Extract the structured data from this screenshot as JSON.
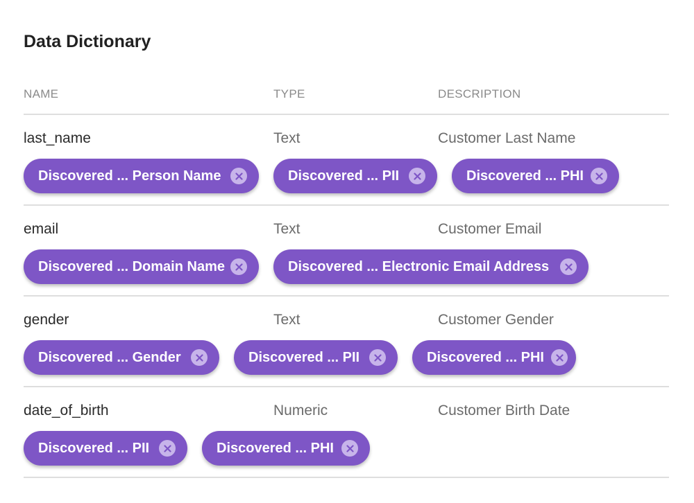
{
  "title": "Data Dictionary",
  "columns": {
    "name": "NAME",
    "type": "TYPE",
    "description": "DESCRIPTION"
  },
  "colors": {
    "chip_background": "#7e56c6",
    "chip_close_background": "#c7b4ea",
    "divider": "#dedede"
  },
  "rows": [
    {
      "name": "last_name",
      "type": "Text",
      "description": "Customer Last Name",
      "tags": [
        {
          "label": "Discovered ... Person Name",
          "icon": "close-circle-icon"
        },
        {
          "label": "Discovered ... PII",
          "icon": "close-circle-icon"
        },
        {
          "label": "Discovered ... PHI",
          "icon": "close-circle-icon"
        }
      ]
    },
    {
      "name": "email",
      "type": "Text",
      "description": "Customer Email",
      "tags": [
        {
          "label": "Discovered ... Domain Name",
          "icon": "close-circle-icon"
        },
        {
          "label": "Discovered ... Electronic Email Address",
          "icon": "close-circle-icon"
        }
      ]
    },
    {
      "name": "gender",
      "type": "Text",
      "description": "Customer Gender",
      "tags": [
        {
          "label": "Discovered ... Gender",
          "icon": "close-circle-icon"
        },
        {
          "label": "Discovered ... PII",
          "icon": "close-circle-icon"
        },
        {
          "label": "Discovered ... PHI",
          "icon": "close-circle-icon"
        }
      ]
    },
    {
      "name": "date_of_birth",
      "type": "Numeric",
      "description": "Customer Birth Date",
      "tags": [
        {
          "label": "Discovered ... PII",
          "icon": "close-circle-icon"
        },
        {
          "label": "Discovered ... PHI",
          "icon": "close-circle-icon"
        }
      ]
    }
  ]
}
